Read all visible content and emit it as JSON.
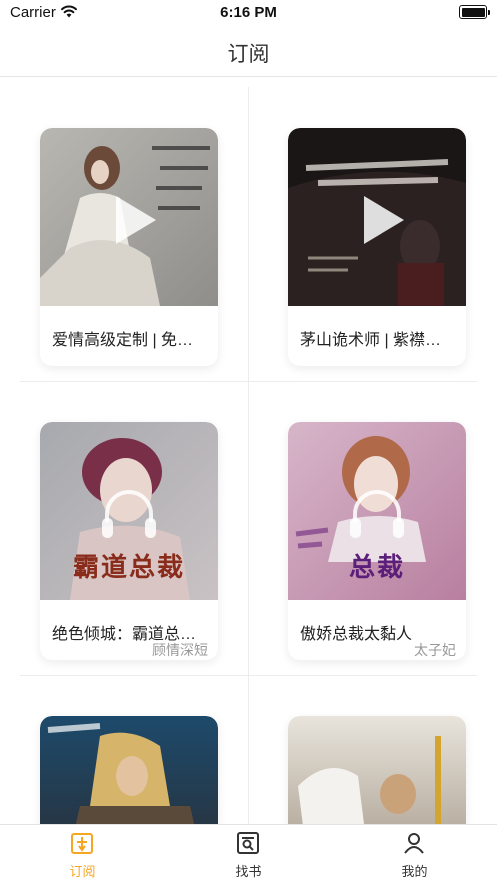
{
  "status_bar": {
    "carrier": "Carrier",
    "time": "6:16 PM"
  },
  "nav": {
    "title": "订阅"
  },
  "items": [
    {
      "title": "爱情高级定制 | 免…",
      "author": "",
      "media": "video",
      "cover_caption": ""
    },
    {
      "title": "茅山诡术师 | 紫襟…",
      "author": "",
      "media": "video",
      "cover_caption": ""
    },
    {
      "title": "绝色倾城：霸道总…",
      "author": "顾情深短",
      "media": "audio",
      "cover_caption": "霸道总裁"
    },
    {
      "title": "傲娇总裁太黏人",
      "author": "太子妃",
      "media": "audio",
      "cover_caption": "总裁"
    },
    {
      "title": "",
      "author": "",
      "media": "",
      "cover_caption": ""
    },
    {
      "title": "",
      "author": "",
      "media": "",
      "cover_caption": ""
    }
  ],
  "tabs": [
    {
      "label": "订阅",
      "icon": "subscribe-icon",
      "active": true
    },
    {
      "label": "找书",
      "icon": "find-book-icon",
      "active": false
    },
    {
      "label": "我的",
      "icon": "profile-icon",
      "active": false
    }
  ],
  "colors": {
    "accent": "#f5a623",
    "divider": "#ececec",
    "author_text": "#999999"
  }
}
